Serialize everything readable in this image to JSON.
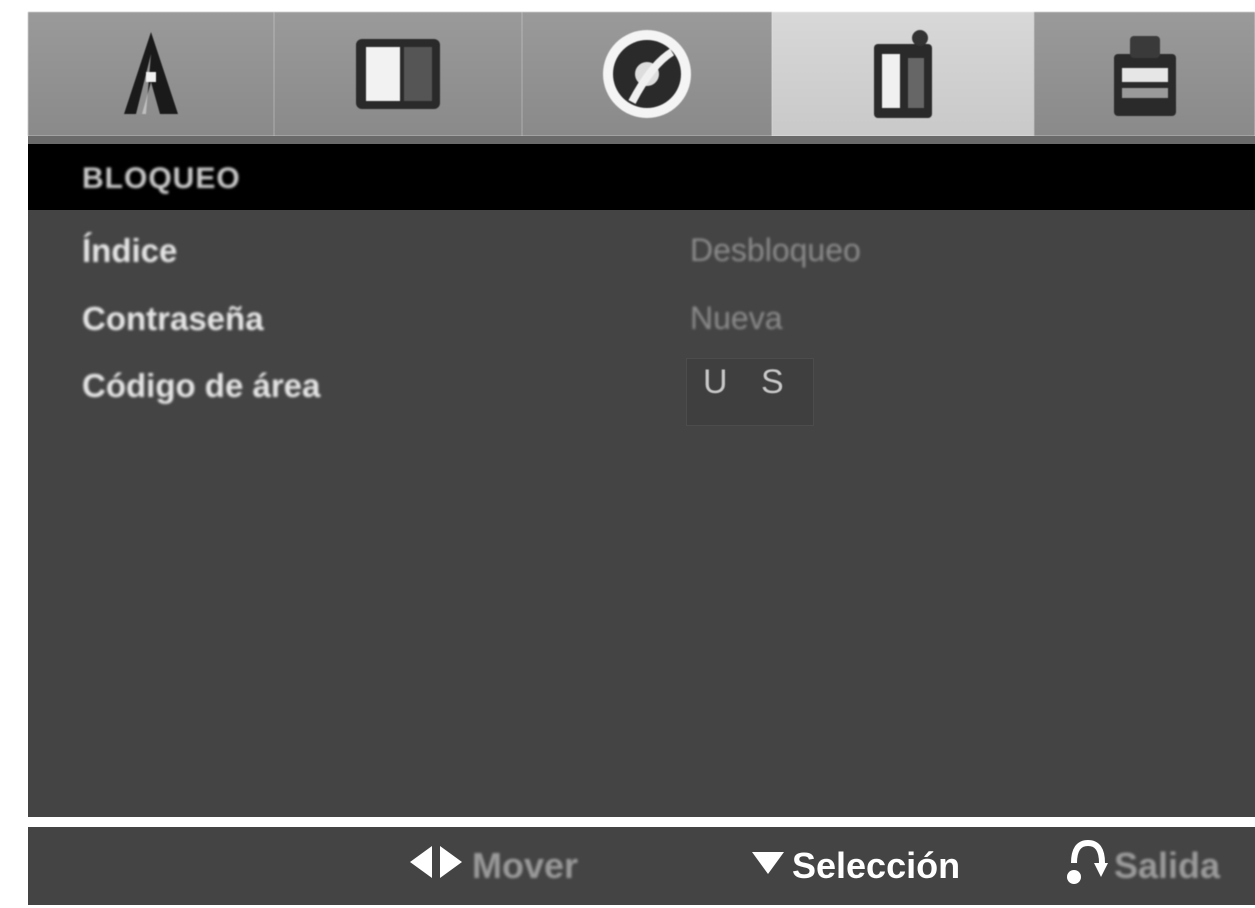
{
  "tabs": [
    {
      "icon": "speaker-icon",
      "selected": false
    },
    {
      "icon": "display-icon",
      "selected": false
    },
    {
      "icon": "disc-icon",
      "selected": false
    },
    {
      "icon": "lock-icon",
      "selected": true
    },
    {
      "icon": "others-icon",
      "selected": false
    }
  ],
  "section": {
    "title": "BLOQUEO"
  },
  "rows": [
    {
      "label": "Índice",
      "value": "Desbloqueo"
    },
    {
      "label": "Contraseña",
      "value": "Nueva"
    },
    {
      "label": "Código de área",
      "value": "U S"
    }
  ],
  "footer": {
    "move_label": "Mover",
    "select_label": "Selección",
    "exit_label": "Salida"
  },
  "colors": {
    "panel": "#444444",
    "header": "#000000",
    "tab": "#8f8f8f",
    "tab_selected": "#d0d0d0"
  }
}
